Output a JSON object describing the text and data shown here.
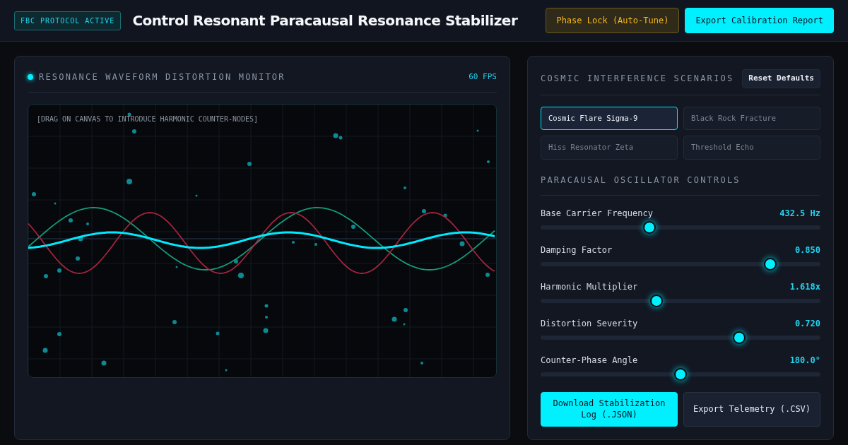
{
  "header": {
    "badge": "FBC PROTOCOL ACTIVE",
    "title": "Control Resonant Paracausal Resonance Stabilizer",
    "buttons": [
      {
        "label": "Phase Lock (Auto-Tune)",
        "kind": "warning"
      },
      {
        "label": "Export Calibration Report",
        "kind": "primary"
      }
    ]
  },
  "monitor": {
    "title": "RESONANCE WAVEFORM DISTORTION MONITOR",
    "fps": "60 FPS",
    "hint": "[DRAG ON CANVAS TO INTRODUCE HARMONIC COUNTER-NODES]"
  },
  "scenarios": {
    "title": "COSMIC INTERFERENCE SCENARIOS",
    "reset": "Reset Defaults",
    "items": [
      {
        "label": "Cosmic Flare Sigma-9",
        "selected": true
      },
      {
        "label": "Black Rock Fracture",
        "selected": false
      },
      {
        "label": "Hiss Resonator Zeta",
        "selected": false
      },
      {
        "label": "Threshold Echo",
        "selected": false
      }
    ]
  },
  "controls": {
    "title": "PARACAUSAL OSCILLATOR CONTROLS",
    "sliders": [
      {
        "label": "Base Carrier Frequency",
        "reading": "432.5 Hz",
        "level": 0.39
      },
      {
        "label": "Damping Factor",
        "reading": "0.850",
        "level": 0.82
      },
      {
        "label": "Harmonic Multiplier",
        "reading": "1.618x",
        "level": 0.415
      },
      {
        "label": "Distortion Severity",
        "reading": "0.720",
        "level": 0.71
      },
      {
        "label": "Counter-Phase Angle",
        "reading": "180.0°",
        "level": 0.5
      }
    ]
  },
  "actions": [
    {
      "label": "Download Stabilization Log (.JSON)",
      "kind": "primary"
    },
    {
      "label": "Export Telemetry (.CSV)",
      "kind": "secondary"
    }
  ]
}
